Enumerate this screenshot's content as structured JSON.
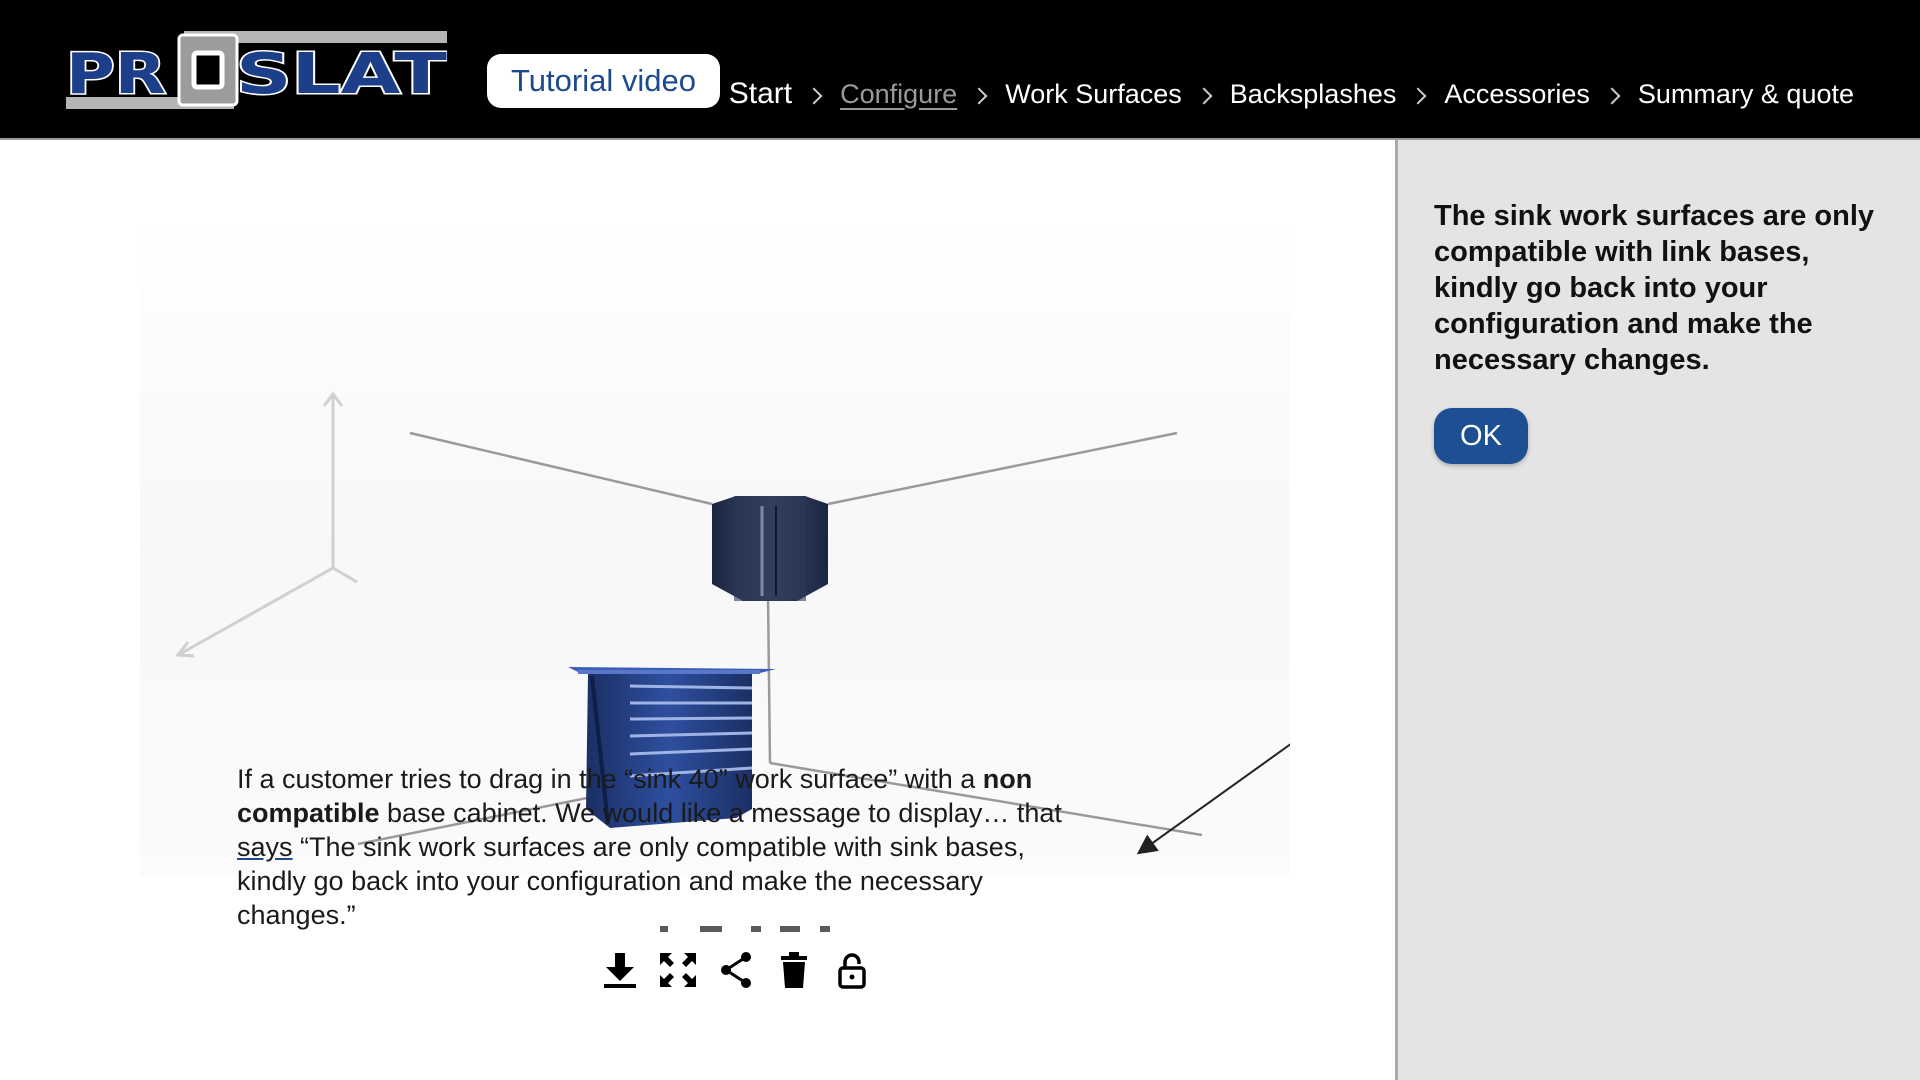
{
  "header": {
    "logo_text": "PROSLAT",
    "tutorial_label": "Tutorial video",
    "breadcrumb": [
      "Start",
      "Configure",
      "Work Surfaces",
      "Backsplashes",
      "Accessories",
      "Summary & quote"
    ],
    "active_step": "Configure"
  },
  "caption": {
    "part1": "If a customer tries to drag in the “sink 40” work surface” with a ",
    "bold": "non compatible",
    "part2": " base cabinet. We would like a message to display… that ",
    "link": "says",
    "part3": " “The sink work surfaces are only compatible with sink bases, kindly go back into your configuration and make the necessary changes.”"
  },
  "toolbar": {
    "icons": [
      "download-icon",
      "fullscreen-icon",
      "share-icon",
      "trash-icon",
      "lock-icon"
    ]
  },
  "panel": {
    "message": "The sink work surfaces are only compatible with link bases, kindly go back into your configuration and make the necessary changes.",
    "ok_label": "OK"
  },
  "colors": {
    "brand_blue": "#1f4f93",
    "header_bg": "#000000",
    "panel_bg": "#e4e4e4"
  }
}
